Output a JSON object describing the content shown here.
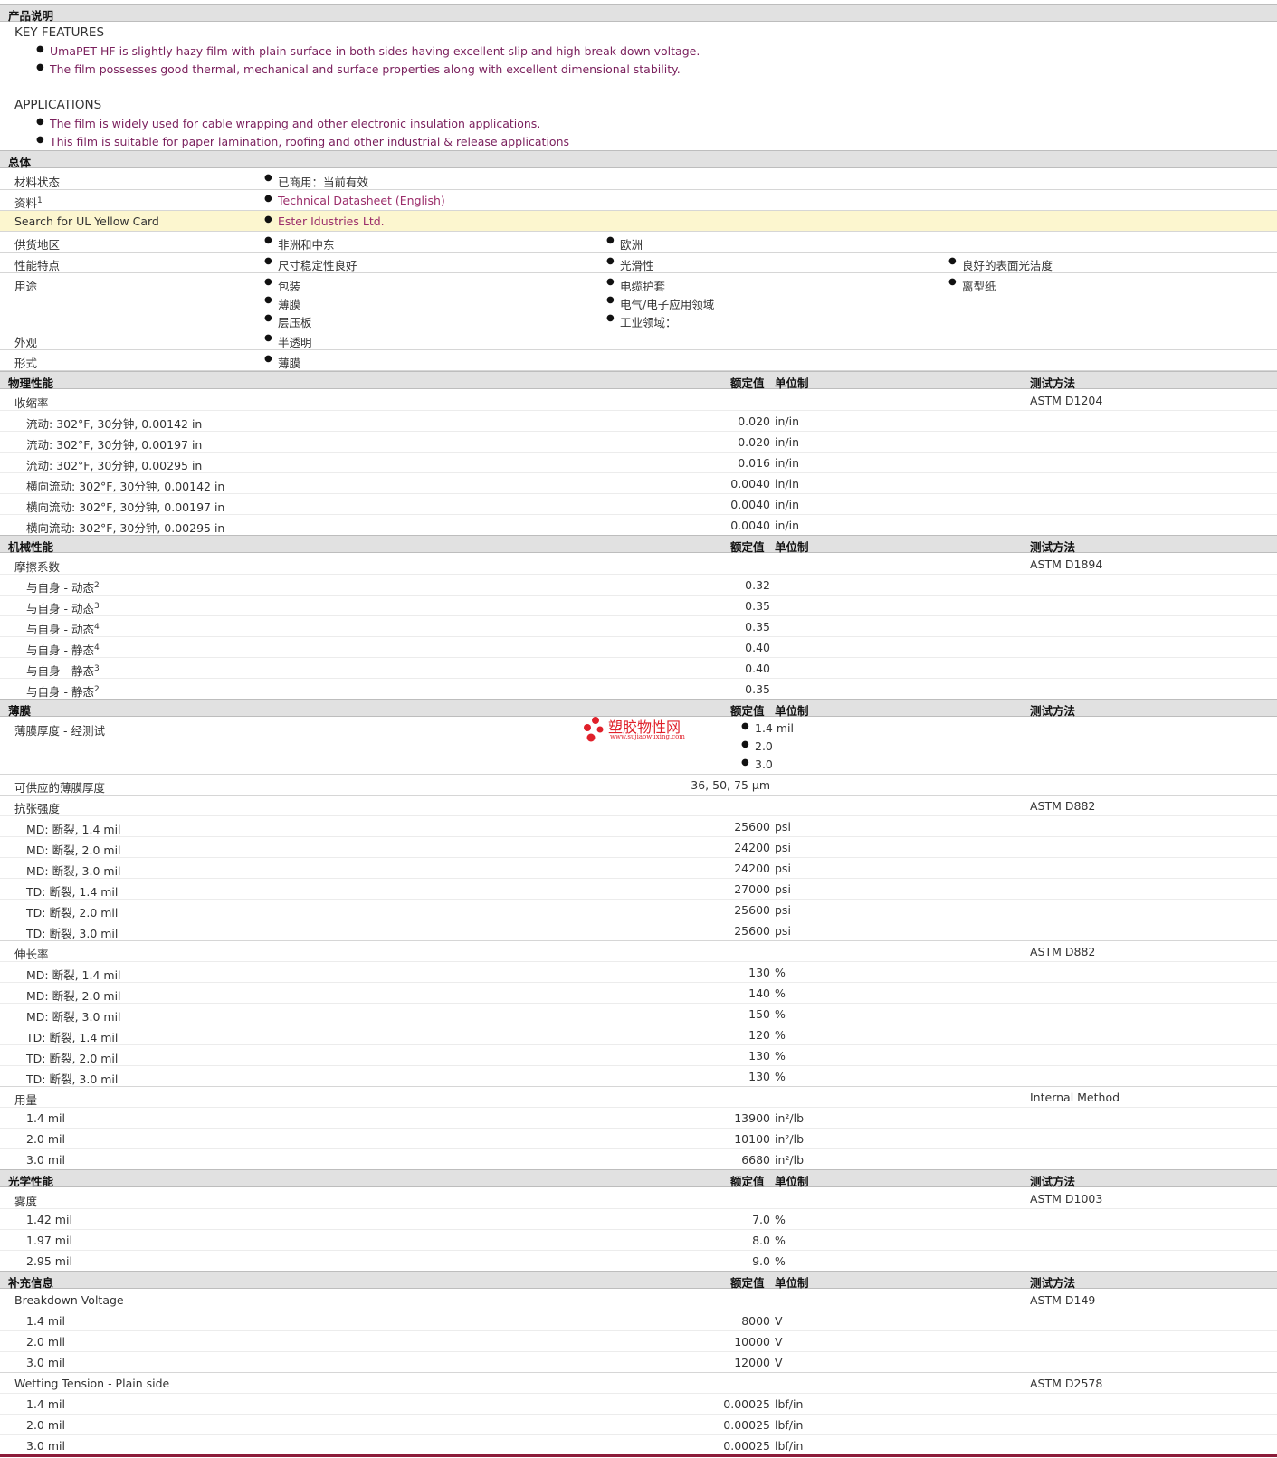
{
  "product_description": {
    "header": "产品说明",
    "key_features_title": "KEY FEATURES",
    "key_features": [
      "UmaPET HF is slightly hazy film with plain surface in both sides having excellent slip and high break down voltage.",
      "The film possesses good thermal, mechanical and surface properties along with excellent dimensional stability."
    ],
    "applications_title": "APPLICATIONS",
    "applications": [
      "The film is widely used for cable wrapping and other electronic insulation applications.",
      "This film is suitable for paper lamination, roofing and other industrial & release applications"
    ]
  },
  "general": {
    "header": "总体",
    "material_status_label": "材料状态",
    "material_status": "已商用：当前有效",
    "docs_label": "资料",
    "docs_sup": "1",
    "docs_link": "Technical Datasheet (English)",
    "ul_label": "Search for UL Yellow Card",
    "ul_link": "Ester Idustries Ltd.",
    "region_label": "供货地区",
    "regions": [
      "非洲和中东",
      "欧洲"
    ],
    "features_label": "性能特点",
    "features": [
      "尺寸稳定性良好",
      "光滑性",
      "良好的表面光洁度"
    ],
    "uses_label": "用途",
    "uses": [
      "包装",
      "电缆护套",
      "离型纸",
      "薄膜",
      "电气/电子应用领域",
      "层压板",
      "工业领域："
    ],
    "appearance_label": "外观",
    "appearance": "半透明",
    "form_label": "形式",
    "form": "薄膜"
  },
  "col_headers": {
    "nominal": "额定值",
    "units": "单位制",
    "method": "测试方法"
  },
  "physical": {
    "header": "物理性能",
    "prop": "收缩率",
    "method": "ASTM D1204",
    "rows": [
      {
        "label": "流动: 302°F, 30分钟, 0.00142 in",
        "value": "0.020",
        "unit": "in/in"
      },
      {
        "label": "流动: 302°F, 30分钟, 0.00197 in",
        "value": "0.020",
        "unit": "in/in"
      },
      {
        "label": "流动: 302°F, 30分钟, 0.00295 in",
        "value": "0.016",
        "unit": "in/in"
      },
      {
        "label": "横向流动: 302°F, 30分钟, 0.00142 in",
        "value": "0.0040",
        "unit": "in/in"
      },
      {
        "label": "横向流动: 302°F, 30分钟, 0.00197 in",
        "value": "0.0040",
        "unit": "in/in"
      },
      {
        "label": "横向流动: 302°F, 30分钟, 0.00295 in",
        "value": "0.0040",
        "unit": "in/in"
      }
    ]
  },
  "mechanical": {
    "header": "机械性能",
    "prop": "摩擦系数",
    "method": "ASTM D1894",
    "rows": [
      {
        "label": "与自身 - 动态",
        "sup": "2",
        "value": "0.32"
      },
      {
        "label": "与自身 - 动态",
        "sup": "3",
        "value": "0.35"
      },
      {
        "label": "与自身 - 动态",
        "sup": "4",
        "value": "0.35"
      },
      {
        "label": "与自身 - 静态",
        "sup": "4",
        "value": "0.40"
      },
      {
        "label": "与自身 - 静态",
        "sup": "3",
        "value": "0.40"
      },
      {
        "label": "与自身 - 静态",
        "sup": "2",
        "value": "0.35"
      }
    ]
  },
  "film": {
    "header": "薄膜",
    "thickness_label": "薄膜厚度 - 经测试",
    "thickness_values": [
      "1.4 mil",
      "2.0",
      "3.0"
    ],
    "avail_label": "可供应的薄膜厚度",
    "avail_value": "36, 50, 75 µm",
    "tensile": {
      "prop": "抗张强度",
      "method": "ASTM D882",
      "rows": [
        {
          "label": "MD: 断裂, 1.4 mil",
          "value": "25600",
          "unit": "psi"
        },
        {
          "label": "MD: 断裂, 2.0 mil",
          "value": "24200",
          "unit": "psi"
        },
        {
          "label": "MD: 断裂, 3.0 mil",
          "value": "24200",
          "unit": "psi"
        },
        {
          "label": "TD: 断裂, 1.4 mil",
          "value": "27000",
          "unit": "psi"
        },
        {
          "label": "TD: 断裂, 2.0 mil",
          "value": "25600",
          "unit": "psi"
        },
        {
          "label": "TD: 断裂, 3.0 mil",
          "value": "25600",
          "unit": "psi"
        }
      ]
    },
    "elongation": {
      "prop": "伸长率",
      "method": "ASTM D882",
      "rows": [
        {
          "label": "MD: 断裂, 1.4 mil",
          "value": "130",
          "unit": "%"
        },
        {
          "label": "MD: 断裂, 2.0 mil",
          "value": "140",
          "unit": "%"
        },
        {
          "label": "MD: 断裂, 3.0 mil",
          "value": "150",
          "unit": "%"
        },
        {
          "label": "TD: 断裂, 1.4 mil",
          "value": "120",
          "unit": "%"
        },
        {
          "label": "TD: 断裂, 2.0 mil",
          "value": "130",
          "unit": "%"
        },
        {
          "label": "TD: 断裂, 3.0 mil",
          "value": "130",
          "unit": "%"
        }
      ]
    },
    "yield": {
      "prop": "用量",
      "method": "Internal Method",
      "rows": [
        {
          "label": "1.4 mil",
          "value": "13900",
          "unit": "in²/lb"
        },
        {
          "label": "2.0 mil",
          "value": "10100",
          "unit": "in²/lb"
        },
        {
          "label": "3.0 mil",
          "value": "6680",
          "unit": "in²/lb"
        }
      ]
    }
  },
  "optical": {
    "header": "光学性能",
    "prop": "雾度",
    "method": "ASTM D1003",
    "rows": [
      {
        "label": "1.42 mil",
        "value": "7.0",
        "unit": "%"
      },
      {
        "label": "1.97 mil",
        "value": "8.0",
        "unit": "%"
      },
      {
        "label": "2.95 mil",
        "value": "9.0",
        "unit": "%"
      }
    ]
  },
  "additional": {
    "header": "补充信息",
    "breakdown": {
      "prop": "Breakdown Voltage",
      "method": "ASTM D149",
      "rows": [
        {
          "label": "1.4 mil",
          "value": "8000",
          "unit": "V"
        },
        {
          "label": "2.0 mil",
          "value": "10000",
          "unit": "V"
        },
        {
          "label": "3.0 mil",
          "value": "12000",
          "unit": "V"
        }
      ]
    },
    "wetting": {
      "prop": "Wetting Tension - Plain side",
      "method": "ASTM D2578",
      "rows": [
        {
          "label": "1.4 mil",
          "value": "0.00025",
          "unit": "lbf/in"
        },
        {
          "label": "2.0 mil",
          "value": "0.00025",
          "unit": "lbf/in"
        },
        {
          "label": "3.0 mil",
          "value": "0.00025",
          "unit": "lbf/in"
        }
      ]
    }
  },
  "watermark": {
    "text": "塑胶物性网",
    "url": "www.sujiaowuxing.com",
    "color": "#e0202a"
  },
  "colors": {
    "purple_text": "#7a1f5c",
    "link": "#9b2d6a",
    "highlight_row": "#fcf6cf",
    "section_bar": "#e1e1e1",
    "bottom_rule": "#8c1c3a"
  }
}
